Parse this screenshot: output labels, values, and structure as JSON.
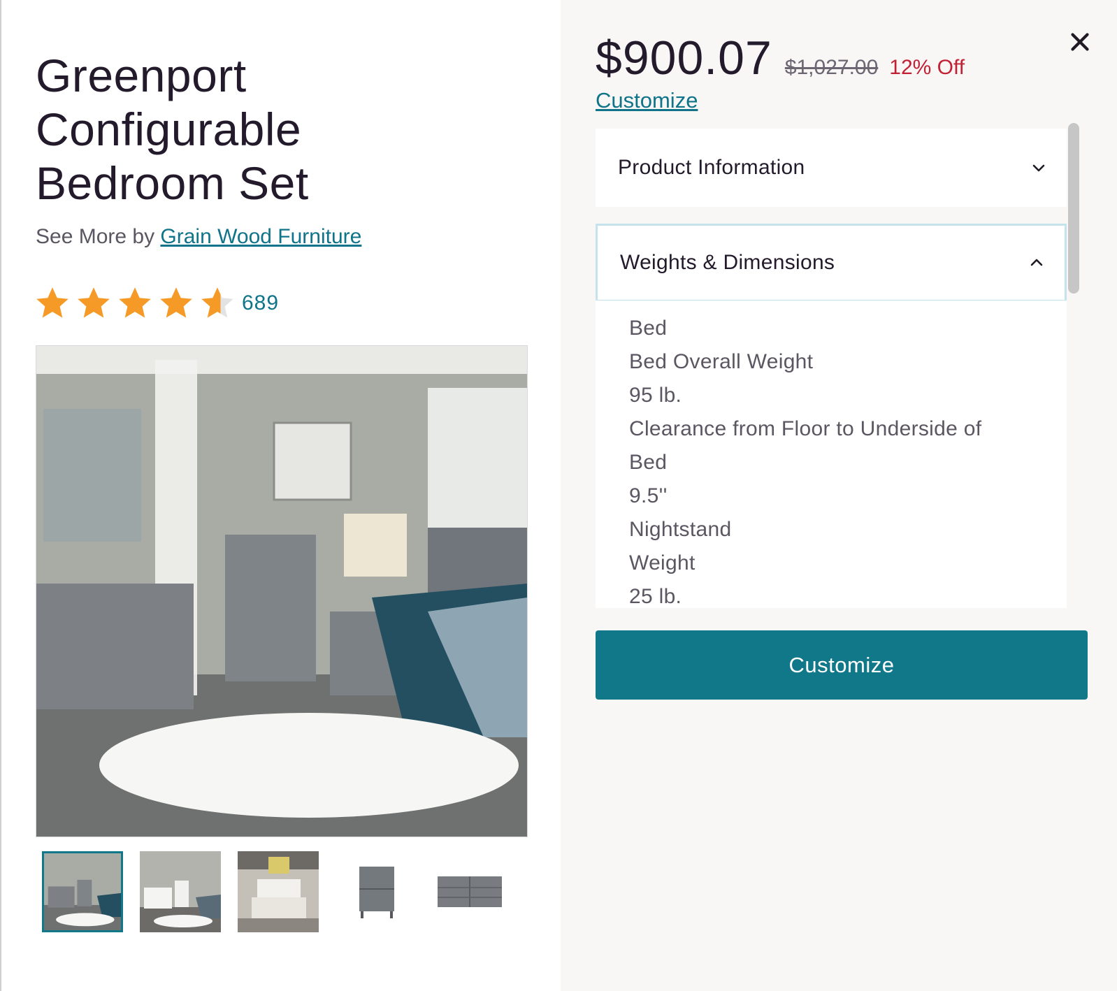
{
  "product": {
    "title_lines": [
      "Greenport",
      "Configurable",
      "Bedroom Set"
    ],
    "see_more_prefix": "See More by ",
    "brand": "Grain Wood Furniture",
    "rating": 4.6,
    "rating_max": 5,
    "review_count": "689"
  },
  "price": {
    "current": "$900.07",
    "original": "$1,027.00",
    "discount": "12% Off"
  },
  "links": {
    "customize": "Customize"
  },
  "accordion": [
    {
      "label": "Product Information",
      "expanded": false,
      "icon": "chevron-down-icon"
    },
    {
      "label": "Weights & Dimensions",
      "expanded": true,
      "icon": "chevron-up-icon"
    }
  ],
  "dimensions": [
    "Bed",
    "Bed Overall Weight",
    "95 lb.",
    "Clearance from Floor to Underside of",
    "Bed",
    "9.5''",
    "Nightstand",
    "Weight",
    "25 lb."
  ],
  "buttons": {
    "customize": "Customize"
  },
  "gallery": {
    "selected_index": 0,
    "thumbnails": [
      "bedroom-scene-thumb",
      "white-bedroom-thumb",
      "bed-wall-art-thumb",
      "nightstand-thumb",
      "dresser-thumb"
    ]
  },
  "colors": {
    "accent": "#11788a",
    "link": "#0f7489",
    "discount": "#c22034",
    "star": "#f59a26"
  }
}
